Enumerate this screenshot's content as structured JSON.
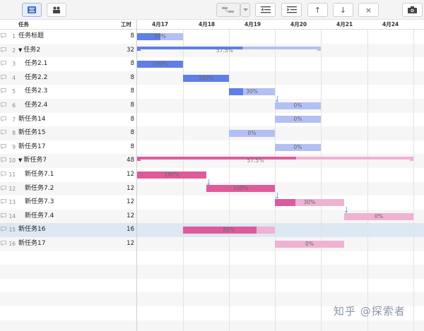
{
  "toolbar": {
    "buttons": [
      {
        "name": "list-view-button",
        "icon": "list-icon"
      },
      {
        "name": "people-view-button",
        "icon": "people-icon"
      },
      {
        "name": "link-mode-button",
        "icon": "link-icon"
      },
      {
        "name": "link-mode-dropdown",
        "icon": "chevron-down-icon"
      },
      {
        "name": "outdent-button",
        "icon": "outdent-icon"
      },
      {
        "name": "indent-button",
        "icon": "indent-icon"
      },
      {
        "name": "move-up-button",
        "icon": "arrow-up-icon",
        "glyph": "↑"
      },
      {
        "name": "move-down-button",
        "icon": "arrow-down-icon",
        "glyph": "↓"
      },
      {
        "name": "delete-button",
        "icon": "close-icon",
        "glyph": "×"
      },
      {
        "name": "screenshot-button",
        "icon": "camera-icon"
      }
    ]
  },
  "header": {
    "task_label": "任务",
    "hours_label": "工时",
    "dates": [
      "4月17",
      "4月18",
      "4月19",
      "4月20",
      "4月21",
      "4月24"
    ]
  },
  "rows": [
    {
      "num": "1",
      "name": "任务标题",
      "hours": "8",
      "indent": 0,
      "caret": false
    },
    {
      "num": "2",
      "name": "任务2",
      "hours": "32",
      "indent": 0,
      "caret": true
    },
    {
      "num": "3",
      "name": "任务2.1",
      "hours": "8",
      "indent": 1,
      "caret": false
    },
    {
      "num": "4",
      "name": "任务2.2",
      "hours": "8",
      "indent": 1,
      "caret": false
    },
    {
      "num": "5",
      "name": "任务2.3",
      "hours": "8",
      "indent": 1,
      "caret": false
    },
    {
      "num": "6",
      "name": "任务2.4",
      "hours": "8",
      "indent": 1,
      "caret": false
    },
    {
      "num": "7",
      "name": "新任务14",
      "hours": "8",
      "indent": 0,
      "caret": false
    },
    {
      "num": "8",
      "name": "新任务15",
      "hours": "8",
      "indent": 0,
      "caret": false
    },
    {
      "num": "9",
      "name": "新任务17",
      "hours": "8",
      "indent": 0,
      "caret": false
    },
    {
      "num": "10",
      "name": "新任务7",
      "hours": "48",
      "indent": 0,
      "caret": true
    },
    {
      "num": "11",
      "name": "新任务7.1",
      "hours": "12",
      "indent": 1,
      "caret": false
    },
    {
      "num": "12",
      "name": "新任务7.2",
      "hours": "12",
      "indent": 1,
      "caret": false
    },
    {
      "num": "13",
      "name": "新任务7.3",
      "hours": "12",
      "indent": 1,
      "caret": false
    },
    {
      "num": "14",
      "name": "新任务7.4",
      "hours": "12",
      "indent": 1,
      "caret": false
    },
    {
      "num": "15",
      "name": "新任务16",
      "hours": "16",
      "indent": 0,
      "caret": false,
      "selected": true
    },
    {
      "num": "16",
      "name": "新任务17",
      "hours": "12",
      "indent": 0,
      "caret": false
    }
  ],
  "bars": [
    {
      "row": 0,
      "type": "task",
      "color": "blue",
      "progress_label": "50%",
      "progress": 0.5
    },
    {
      "row": 1,
      "type": "summary",
      "color": "blue",
      "progress_label": "57.5%",
      "progress": 0.575
    },
    {
      "row": 2,
      "type": "task",
      "color": "blue",
      "progress_label": "100%",
      "progress": 1
    },
    {
      "row": 3,
      "type": "task",
      "color": "blue",
      "progress_label": "100%",
      "progress": 1
    },
    {
      "row": 4,
      "type": "task",
      "color": "blue",
      "progress_label": "30%",
      "progress": 0.3
    },
    {
      "row": 5,
      "type": "task",
      "color": "blue",
      "progress_label": "0%",
      "progress": 0
    },
    {
      "row": 6,
      "type": "task",
      "color": "blue",
      "progress_label": "0%",
      "progress": 0
    },
    {
      "row": 7,
      "type": "task",
      "color": "blue",
      "progress_label": "0%",
      "progress": 0
    },
    {
      "row": 8,
      "type": "task",
      "color": "blue",
      "progress_label": "0%",
      "progress": 0
    },
    {
      "row": 9,
      "type": "summary",
      "color": "pink",
      "progress_label": "57.5%",
      "progress": 0.575
    },
    {
      "row": 10,
      "type": "task",
      "color": "pink",
      "progress_label": "100%",
      "progress": 1
    },
    {
      "row": 11,
      "type": "task",
      "color": "pink",
      "progress_label": "100%",
      "progress": 1
    },
    {
      "row": 12,
      "type": "task",
      "color": "pink",
      "progress_label": "30%",
      "progress": 0.3
    },
    {
      "row": 13,
      "type": "task",
      "color": "pink",
      "progress_label": "0%",
      "progress": 0
    },
    {
      "row": 14,
      "type": "task",
      "color": "pink",
      "progress_label": "80%",
      "progress": 0.8
    },
    {
      "row": 15,
      "type": "task",
      "color": "pink",
      "progress_label": "0%",
      "progress": 0
    }
  ],
  "colors": {
    "blue_fill": "#5f7fe6",
    "blue_light": "#b3c0f3",
    "pink_fill": "#de5b9b",
    "pink_light": "#efb2d3",
    "selected_row": "#dde8f2"
  },
  "watermark": "知乎 @探索者"
}
